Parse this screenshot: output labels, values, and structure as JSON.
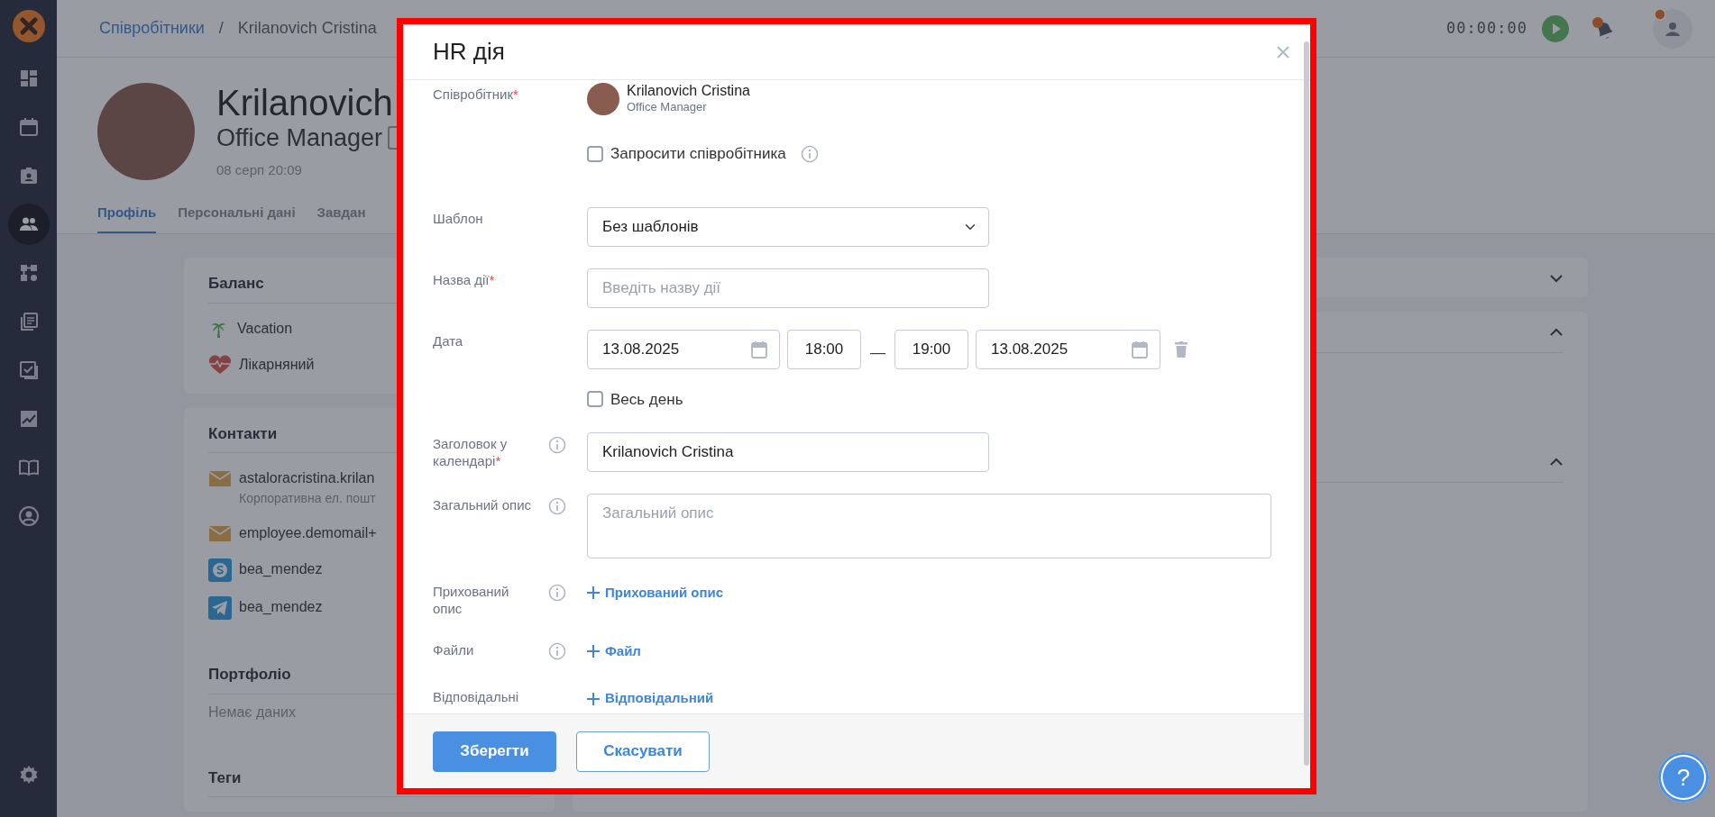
{
  "sidebar": {
    "items": [
      {
        "selected": false
      },
      {
        "selected": false
      },
      {
        "selected": false
      },
      {
        "selected": true
      },
      {
        "selected": false
      },
      {
        "selected": false
      },
      {
        "selected": false
      },
      {
        "selected": false
      },
      {
        "selected": false
      },
      {
        "selected": false
      }
    ]
  },
  "breadcrumb": {
    "items": [
      {
        "label": "Співробітники",
        "kind": "link"
      },
      {
        "label": "Krilanovich Cristina",
        "kind": "current"
      }
    ],
    "separator": "/"
  },
  "timer": "00:00:00",
  "profile": {
    "name": "Krilanovich",
    "position": "Office Manager",
    "updated": "08 серп 20:09"
  },
  "tabs": [
    {
      "label": "Профіль",
      "selected": true
    },
    {
      "label": "Персональні дані",
      "selected": false
    },
    {
      "label": "Завдан",
      "selected": false
    }
  ],
  "balance": {
    "title": "Баланс",
    "items": [
      {
        "label": "Vacation",
        "kind": "vacation"
      },
      {
        "label": "Лікарняний",
        "kind": "sick"
      }
    ]
  },
  "contacts": {
    "title": "Контакти",
    "items": [
      {
        "kind": "email",
        "value": "astaloracristina.krilan",
        "note": "Корпоративна ел. пошт"
      },
      {
        "kind": "email",
        "value": "employee.demomail+"
      },
      {
        "kind": "skype",
        "value": "bea_mendez"
      },
      {
        "kind": "telegram",
        "value": "bea_mendez"
      }
    ]
  },
  "portfolio": {
    "title": "Портфоліо",
    "empty": "Немає даних"
  },
  "tags": {
    "title": "Теги"
  },
  "right_panels": [
    {
      "sections": [
        {
          "expanded": false
        }
      ]
    },
    {
      "sections": [
        {
          "expanded": true
        },
        {
          "expanded": true
        }
      ]
    }
  ],
  "modal": {
    "title": "HR дія",
    "fields": [
      {
        "kind": "employee",
        "label": "Співробітник",
        "required_mark": "*",
        "name": "Krilanovich Cristina",
        "role": "Office Manager",
        "invite": {
          "label": "Запросити співробітника",
          "checked": false,
          "info": true
        }
      },
      {
        "kind": "select",
        "label": "Шаблон",
        "value": "Без шаблонів"
      },
      {
        "kind": "text",
        "label": "Назва дії",
        "required_mark": "*",
        "placeholder": "Введіть назву дії"
      },
      {
        "kind": "daterange",
        "label": "Дата",
        "start_date": "13.08.2025",
        "start_time": "18:00",
        "separator": "—",
        "end_time": "19:00",
        "end_date": "13.08.2025",
        "all_day": {
          "label": "Весь день",
          "checked": false
        }
      },
      {
        "kind": "text",
        "label": "Заголовок у календарі",
        "required_mark": "*",
        "info": true,
        "value": "Krilanovich Cristina"
      },
      {
        "kind": "textarea",
        "label": "Загальний опис",
        "info": true,
        "placeholder": "Загальний опис"
      },
      {
        "kind": "add",
        "label": "Прихований опис",
        "info": true,
        "action": "Прихований опис"
      },
      {
        "kind": "add",
        "label": "Файли",
        "info": true,
        "action": "Файл"
      },
      {
        "kind": "add",
        "label": "Відповідальні",
        "action": "Відповідальний"
      }
    ],
    "buttons": [
      {
        "label": "Зберегти",
        "kind": "primary"
      },
      {
        "label": "Скасувати",
        "kind": "secondary"
      }
    ]
  },
  "help": "?"
}
